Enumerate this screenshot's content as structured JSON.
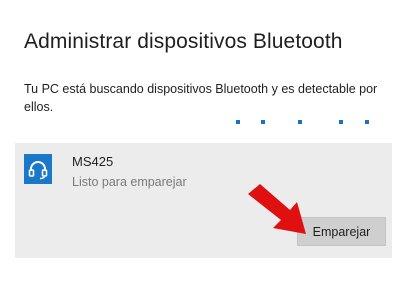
{
  "dialog": {
    "title": "Administrar dispositivos Bluetooth",
    "status": "Tu PC está buscando dispositivos Bluetooth y es detectable por ellos."
  },
  "device": {
    "name": "MS425",
    "status": "Listo para emparejar",
    "icon": "headset-icon"
  },
  "actions": {
    "pair_label": "Emparejar"
  },
  "colors": {
    "accent": "#1a78c9",
    "panel": "#ececec",
    "button": "#cfcfcf",
    "arrow": "#e01010"
  }
}
